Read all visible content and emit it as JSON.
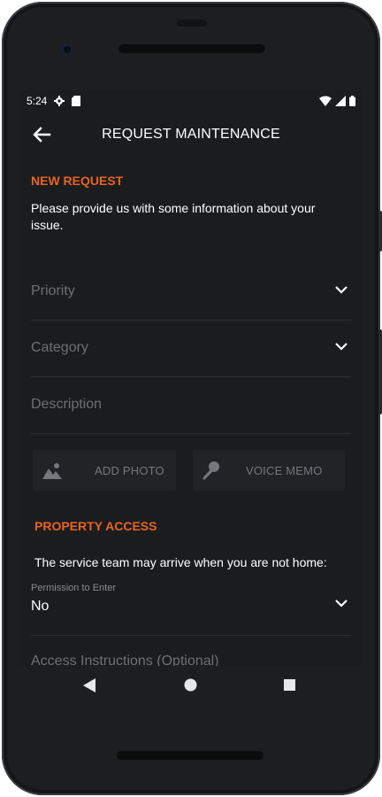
{
  "status_bar": {
    "time": "5:24"
  },
  "app_bar": {
    "title": "REQUEST MAINTENANCE"
  },
  "new_request": {
    "label": "NEW REQUEST",
    "prompt": "Please provide us with some information about your issue.",
    "fields": {
      "priority": "Priority",
      "category": "Category",
      "description": "Description"
    },
    "add_photo": "ADD PHOTO",
    "voice_memo": "VOICE MEMO"
  },
  "property_access": {
    "label": "PROPERTY ACCESS",
    "note": "The service team may arrive when you are not home:",
    "permission_label": "Permission to Enter",
    "permission_value": "No",
    "instructions_placeholder": "Access Instructions (Optional)"
  },
  "colors": {
    "accent": "#e8631f",
    "background": "#1b1c1e",
    "placeholder": "#6d7075"
  },
  "icons": [
    "back-arrow-icon",
    "settings-icon",
    "sim-card-icon",
    "wifi-icon",
    "signal-icon",
    "battery-icon",
    "chevron-down-icon",
    "image-icon",
    "microphone-icon",
    "nav-back-icon",
    "nav-home-icon",
    "nav-recents-icon"
  ]
}
